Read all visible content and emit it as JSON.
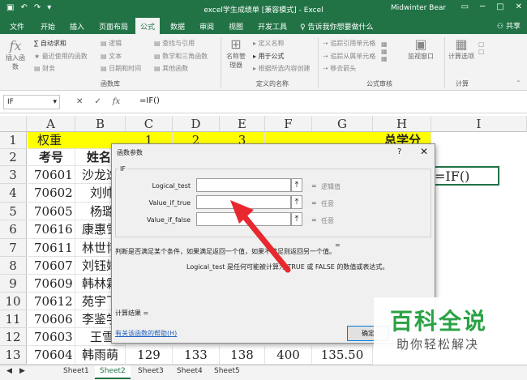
{
  "window": {
    "title": "excel学生成绩单 [兼容模式] - Excel",
    "user": "Midwinter Bear",
    "qat_icons": [
      "save-icon",
      "undo-icon",
      "redo-icon",
      "customize-icon"
    ],
    "controls": [
      "restore-icon",
      "minimize-icon",
      "maximize-icon",
      "close-icon"
    ]
  },
  "menu": {
    "tabs": [
      "文件",
      "开始",
      "插入",
      "页面布局",
      "公式",
      "数据",
      "审阅",
      "视图",
      "开发工具"
    ],
    "active": "公式",
    "tell_me": "告诉我你想要做什么",
    "share": "共享"
  },
  "ribbon": {
    "insert_function": {
      "icon": "fx",
      "label": "插入函数"
    },
    "library": {
      "items": [
        "∑ 自动求和",
        "最近使用的函数",
        "财务",
        "逻辑",
        "文本",
        "日期和时间",
        "查找与引用",
        "数学和三角函数",
        "其他函数"
      ],
      "label": "函数库"
    },
    "names": {
      "manager": "名称管理器",
      "items": [
        "定义名称",
        "用于公式",
        "根据所选内容创建"
      ],
      "label": "定义的名称"
    },
    "audit": {
      "items": [
        "追踪引用单元格",
        "追踪从属单元格",
        "移去箭头"
      ],
      "watch": "监视窗口",
      "label": "公式审核"
    },
    "calc": {
      "item": "计算选项",
      "label": "计算"
    }
  },
  "formula_bar": {
    "name_box": "IF",
    "buttons": [
      "✕",
      "✓",
      "fx"
    ],
    "formula": "=IF()"
  },
  "grid": {
    "columns": [
      "A",
      "B",
      "C",
      "D",
      "E",
      "F",
      "G",
      "H",
      "I"
    ],
    "rows": [
      "1",
      "2",
      "3",
      "4",
      "5",
      "6",
      "7",
      "8",
      "9",
      "10",
      "11",
      "12",
      "13"
    ],
    "row1": {
      "weight": "权重",
      "c": "1",
      "d": "2",
      "e": "3",
      "h": "总学分"
    },
    "row2": {
      "id": "考号",
      "name": "姓名"
    },
    "students": [
      {
        "id": "70601",
        "name": "沙龙逸"
      },
      {
        "id": "70602",
        "name": "刘帅"
      },
      {
        "id": "70605",
        "name": "杨璐"
      },
      {
        "id": "70616",
        "name": "康惠雪"
      },
      {
        "id": "70611",
        "name": "林世博"
      },
      {
        "id": "70607",
        "name": "刘钰婷"
      },
      {
        "id": "70609",
        "name": "韩林霖"
      },
      {
        "id": "70612",
        "name": "苑宇飞"
      },
      {
        "id": "70606",
        "name": "李鉴学"
      },
      {
        "id": "70603",
        "name": "王雪"
      },
      {
        "id": "70604",
        "name": "韩雨萌",
        "c": "129",
        "d": "133",
        "e": "138",
        "f": "400",
        "g": "135.50"
      }
    ],
    "active_cell": "=IF()"
  },
  "sheets": {
    "tabs": [
      "Sheet1",
      "Sheet2",
      "Sheet3",
      "Sheet4",
      "Sheet5"
    ],
    "active": "Sheet2"
  },
  "dialog": {
    "title": "函数参数",
    "help": "?",
    "close": "✕",
    "function": "IF",
    "args": [
      {
        "label": "Logical_test",
        "hint": "逻辑值"
      },
      {
        "label": "Value_if_true",
        "hint": "任意"
      },
      {
        "label": "Value_if_false",
        "hint": "任意"
      }
    ],
    "eq": "=",
    "description": "判断是否满足某个条件，如果满足返回一个值，如果不满足则返回另一个值。",
    "arg_description": "Logical_test   是任何可能被计算为 TRUE 或 FALSE 的数值或表达式。",
    "result": "计算结果 =",
    "help_link": "有关该函数的帮助(H)",
    "ok": "确定"
  },
  "watermark": {
    "title": "百科全说",
    "subtitle": "助你轻松解决"
  },
  "colors": {
    "excel_green": "#217346",
    "highlight_yellow": "#ffff00",
    "arrow_red": "#e8282f",
    "watermark_green": "#2ba244"
  }
}
